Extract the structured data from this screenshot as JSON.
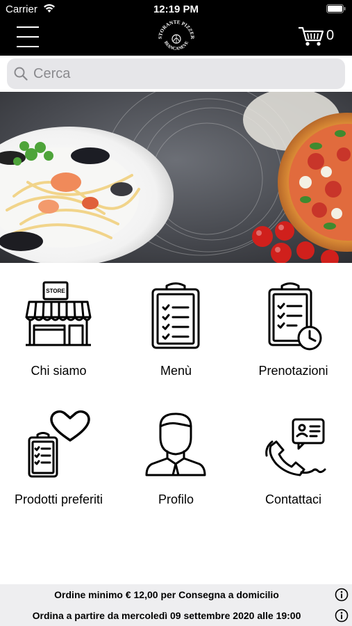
{
  "status_bar": {
    "carrier": "Carrier",
    "time": "12:19 PM",
    "wifi_icon": "wifi-icon",
    "battery_icon": "battery-icon"
  },
  "navbar": {
    "menu_icon": "hamburger-menu-icon",
    "logo_text_top": "RISTORANTE PIZZERIA",
    "logo_text_bottom": "BIANCANEVE",
    "cart_icon": "shopping-cart-icon",
    "cart_count": "0"
  },
  "search": {
    "placeholder": "Cerca",
    "value": ""
  },
  "menu_tiles": [
    {
      "label": "Chi siamo",
      "icon": "store-icon",
      "store_sign": "STORE"
    },
    {
      "label": "Menù",
      "icon": "clipboard-checklist-icon"
    },
    {
      "label": "Prenotazioni",
      "icon": "clipboard-clock-icon"
    },
    {
      "label": "Prodotti preferiti",
      "icon": "clipboard-heart-icon"
    },
    {
      "label": "Profilo",
      "icon": "user-profile-icon"
    },
    {
      "label": "Contattaci",
      "icon": "phone-contact-icon"
    }
  ],
  "footer": {
    "line1": "Ordine minimo € 12,00 per Consegna a domicilio",
    "line2": "Ordina a partire da mercoledì 09 settembre 2020 alle 19:00",
    "info_icon": "info-icon"
  },
  "colors": {
    "header_bg": "#000000",
    "search_bg": "#e6e6e9",
    "footer_bg": "#eeeef0"
  }
}
